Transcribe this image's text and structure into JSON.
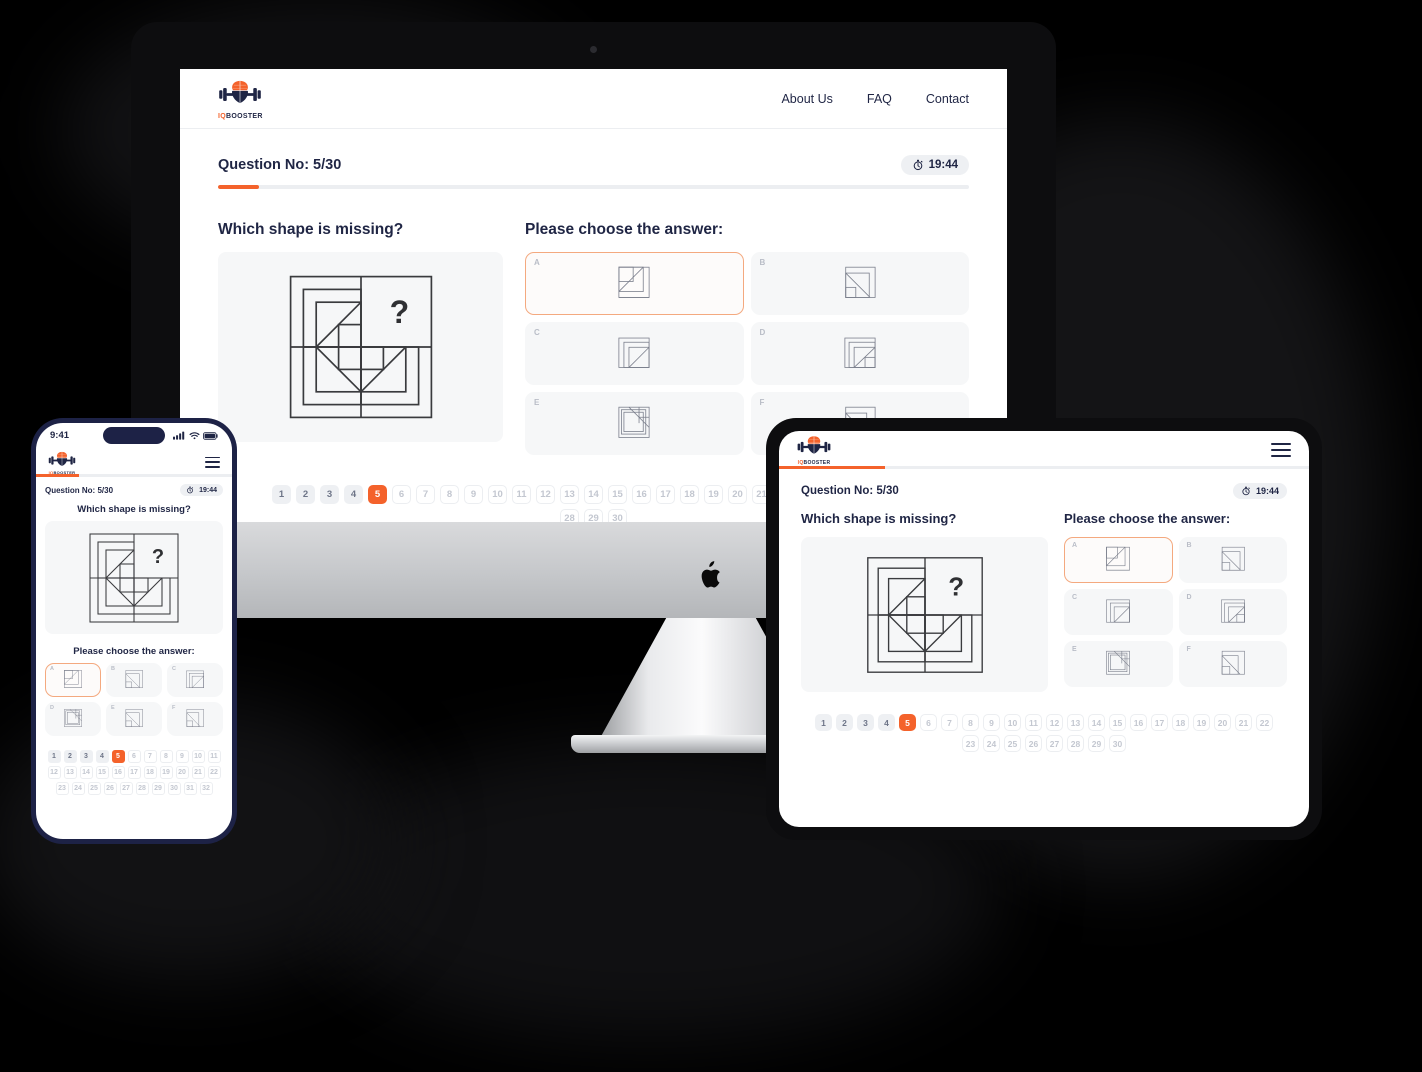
{
  "brand": {
    "name_part1": "IQ",
    "name_part2": "BOOSTER",
    "logo_icon": "brain-barbell-logo-icon",
    "accent_color": "#f4622b",
    "text_color": "#1f2544"
  },
  "nav": {
    "links": [
      {
        "label": "About Us"
      },
      {
        "label": "FAQ"
      },
      {
        "label": "Contact"
      }
    ],
    "menu_icon": "hamburger-menu-icon"
  },
  "quiz": {
    "question_label": "Question No: 5/30",
    "current_question": 5,
    "total_questions": 30,
    "progress_percent": 5.5,
    "timer": {
      "value": "19:44",
      "icon": "stopwatch-icon"
    },
    "prompt": "Which shape is missing?",
    "answer_prompt": "Please choose the answer:",
    "missing_marker": "?",
    "options": [
      {
        "letter": "A",
        "selected": true
      },
      {
        "letter": "B",
        "selected": false
      },
      {
        "letter": "C",
        "selected": false
      },
      {
        "letter": "D",
        "selected": false
      },
      {
        "letter": "E",
        "selected": false
      },
      {
        "letter": "F",
        "selected": false
      }
    ],
    "pager_desktop": [
      {
        "n": "1",
        "state": "done"
      },
      {
        "n": "2",
        "state": "done"
      },
      {
        "n": "3",
        "state": "done"
      },
      {
        "n": "4",
        "state": "done"
      },
      {
        "n": "5",
        "state": "cur"
      },
      {
        "n": "6",
        "state": "todo"
      },
      {
        "n": "7",
        "state": "todo"
      },
      {
        "n": "8",
        "state": "todo"
      },
      {
        "n": "9",
        "state": "todo"
      },
      {
        "n": "10",
        "state": "todo"
      },
      {
        "n": "11",
        "state": "todo"
      },
      {
        "n": "12",
        "state": "todo"
      },
      {
        "n": "13",
        "state": "todo"
      },
      {
        "n": "14",
        "state": "todo"
      },
      {
        "n": "15",
        "state": "todo"
      },
      {
        "n": "16",
        "state": "todo"
      },
      {
        "n": "17",
        "state": "todo"
      },
      {
        "n": "18",
        "state": "todo"
      },
      {
        "n": "19",
        "state": "todo"
      },
      {
        "n": "20",
        "state": "todo"
      },
      {
        "n": "21",
        "state": "todo"
      },
      {
        "n": "22",
        "state": "todo"
      },
      {
        "n": "23",
        "state": "todo"
      },
      {
        "n": "24",
        "state": "todo"
      },
      {
        "n": "25",
        "state": "todo"
      },
      {
        "n": "26",
        "state": "todo"
      },
      {
        "n": "27",
        "state": "todo"
      },
      {
        "n": "28",
        "state": "todo"
      },
      {
        "n": "29",
        "state": "todo"
      },
      {
        "n": "30",
        "state": "todo"
      }
    ],
    "pager_phone": [
      {
        "n": "1",
        "state": "done"
      },
      {
        "n": "2",
        "state": "done"
      },
      {
        "n": "3",
        "state": "done"
      },
      {
        "n": "4",
        "state": "done"
      },
      {
        "n": "5",
        "state": "cur"
      },
      {
        "n": "6",
        "state": "todo"
      },
      {
        "n": "7",
        "state": "todo"
      },
      {
        "n": "8",
        "state": "todo"
      },
      {
        "n": "9",
        "state": "todo"
      },
      {
        "n": "10",
        "state": "todo"
      },
      {
        "n": "11",
        "state": "todo"
      },
      {
        "n": "12",
        "state": "todo"
      },
      {
        "n": "13",
        "state": "todo"
      },
      {
        "n": "14",
        "state": "todo"
      },
      {
        "n": "15",
        "state": "todo"
      },
      {
        "n": "16",
        "state": "todo"
      },
      {
        "n": "17",
        "state": "todo"
      },
      {
        "n": "18",
        "state": "todo"
      },
      {
        "n": "19",
        "state": "todo"
      },
      {
        "n": "20",
        "state": "todo"
      },
      {
        "n": "21",
        "state": "todo"
      },
      {
        "n": "22",
        "state": "todo"
      },
      {
        "n": "23",
        "state": "todo"
      },
      {
        "n": "24",
        "state": "todo"
      },
      {
        "n": "25",
        "state": "todo"
      },
      {
        "n": "26",
        "state": "todo"
      },
      {
        "n": "27",
        "state": "todo"
      },
      {
        "n": "28",
        "state": "todo"
      },
      {
        "n": "29",
        "state": "todo"
      },
      {
        "n": "30",
        "state": "todo"
      },
      {
        "n": "31",
        "state": "todo"
      },
      {
        "n": "32",
        "state": "todo"
      }
    ]
  },
  "phone": {
    "status_time": "9:41",
    "signal_icon": "cellular-signal-icon",
    "wifi_icon": "wifi-icon",
    "battery_icon": "battery-icon"
  },
  "devices": {
    "desktop_label": "imac-desktop-mockup",
    "tablet_label": "ipad-tablet-mockup",
    "phone_label": "iphone-mockup",
    "apple_logo_icon": "apple-logo-icon",
    "camera_icon": "webcam-icon"
  }
}
